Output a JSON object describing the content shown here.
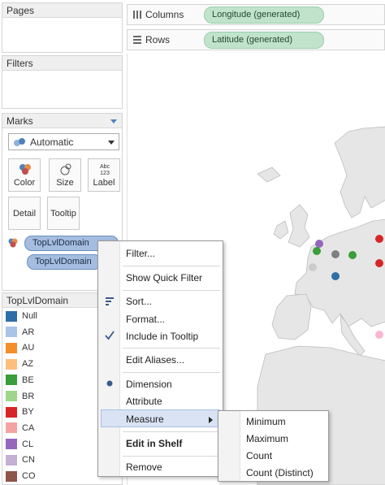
{
  "cards": {
    "pages": "Pages",
    "filters": "Filters",
    "marks": "Marks"
  },
  "marks": {
    "type": "Automatic",
    "buttons": [
      "Color",
      "Size",
      "Label",
      "Detail",
      "Tooltip"
    ],
    "label_icon_text": "Abc\n123",
    "pills": [
      "TopLvlDomain",
      "TopLvlDomain"
    ]
  },
  "shelves": {
    "columns_label": "Columns",
    "columns_pill": "Longitude (generated)",
    "rows_label": "Rows",
    "rows_pill": "Latitude (generated)"
  },
  "legend": {
    "title": "TopLvlDomain",
    "items": [
      {
        "label": "Null",
        "color": "#2f6fa8"
      },
      {
        "label": "AR",
        "color": "#a9c4e6"
      },
      {
        "label": "AU",
        "color": "#f28e2b"
      },
      {
        "label": "AZ",
        "color": "#ffbe7d"
      },
      {
        "label": "BE",
        "color": "#3a9e3a"
      },
      {
        "label": "BR",
        "color": "#9fd68a"
      },
      {
        "label": "BY",
        "color": "#d62728"
      },
      {
        "label": "CA",
        "color": "#f4a3a3"
      },
      {
        "label": "CL",
        "color": "#9467bd"
      },
      {
        "label": "CN",
        "color": "#c5b0d5"
      },
      {
        "label": "CO",
        "color": "#8c564b"
      }
    ]
  },
  "context_menu": {
    "items": [
      {
        "label": "Filter...",
        "bold": false
      },
      {
        "label": "Show Quick Filter",
        "bold": false
      },
      {
        "label": "Sort...",
        "bold": false
      },
      {
        "label": "Format...",
        "bold": false
      },
      {
        "label": "Include in Tooltip",
        "bold": false
      },
      {
        "label": "Edit Aliases...",
        "bold": false
      },
      {
        "label": "Dimension",
        "bold": false
      },
      {
        "label": "Attribute",
        "bold": false
      },
      {
        "label": "Measure",
        "bold": false
      },
      {
        "label": "Edit in Shelf",
        "bold": true
      },
      {
        "label": "Remove",
        "bold": false
      }
    ]
  },
  "submenu": {
    "items": [
      "Minimum",
      "Maximum",
      "Count",
      "Count (Distinct)"
    ]
  },
  "map_points": [
    {
      "color": "#9467bd"
    },
    {
      "color": "#3a9e3a"
    },
    {
      "color": "#7f7f7f"
    },
    {
      "color": "#3a9e3a"
    },
    {
      "color": "#cccccc"
    },
    {
      "color": "#2f6fa8"
    },
    {
      "color": "#d62728"
    },
    {
      "color": "#d62728"
    },
    {
      "color": "#f7b6d2"
    }
  ]
}
